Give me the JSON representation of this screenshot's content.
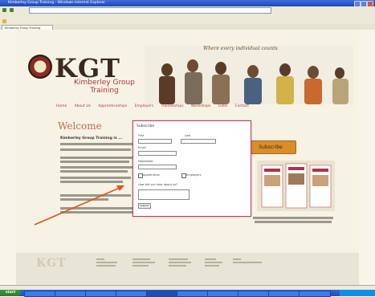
{
  "browser": {
    "title": "Kimberley Group Training - Windows Internet Explorer",
    "tab_label": "Kimberley Group Training"
  },
  "site": {
    "logo_text": "KGT",
    "tagline": "Kimberley Group Training",
    "people_caption": "Where every individual counts",
    "nav": [
      "Home",
      "About Us",
      "Apprenticeships",
      "Employers",
      "Traineeships",
      "Workshops",
      "Links",
      "Contact"
    ],
    "welcome": "Welcome",
    "content_heading": "Kimberley Group Training is ...",
    "subscribe_label": "Subscribe",
    "footer_logo": "KGT"
  },
  "modal": {
    "title": "Subscribe",
    "fields": [
      "First",
      "Last",
      "Email",
      "Newsletter"
    ],
    "checkbox_labels": [
      "Apprentices",
      "Employers"
    ],
    "comments_label": "How did you hear about us?",
    "submit_label": "Submit"
  },
  "taskbar": {
    "start_label": "start"
  },
  "colors": {
    "accent": "#b3304a",
    "subscribe": "#d98e2a",
    "modal_border": "#c23c6a",
    "arrow": "#e0531c"
  }
}
